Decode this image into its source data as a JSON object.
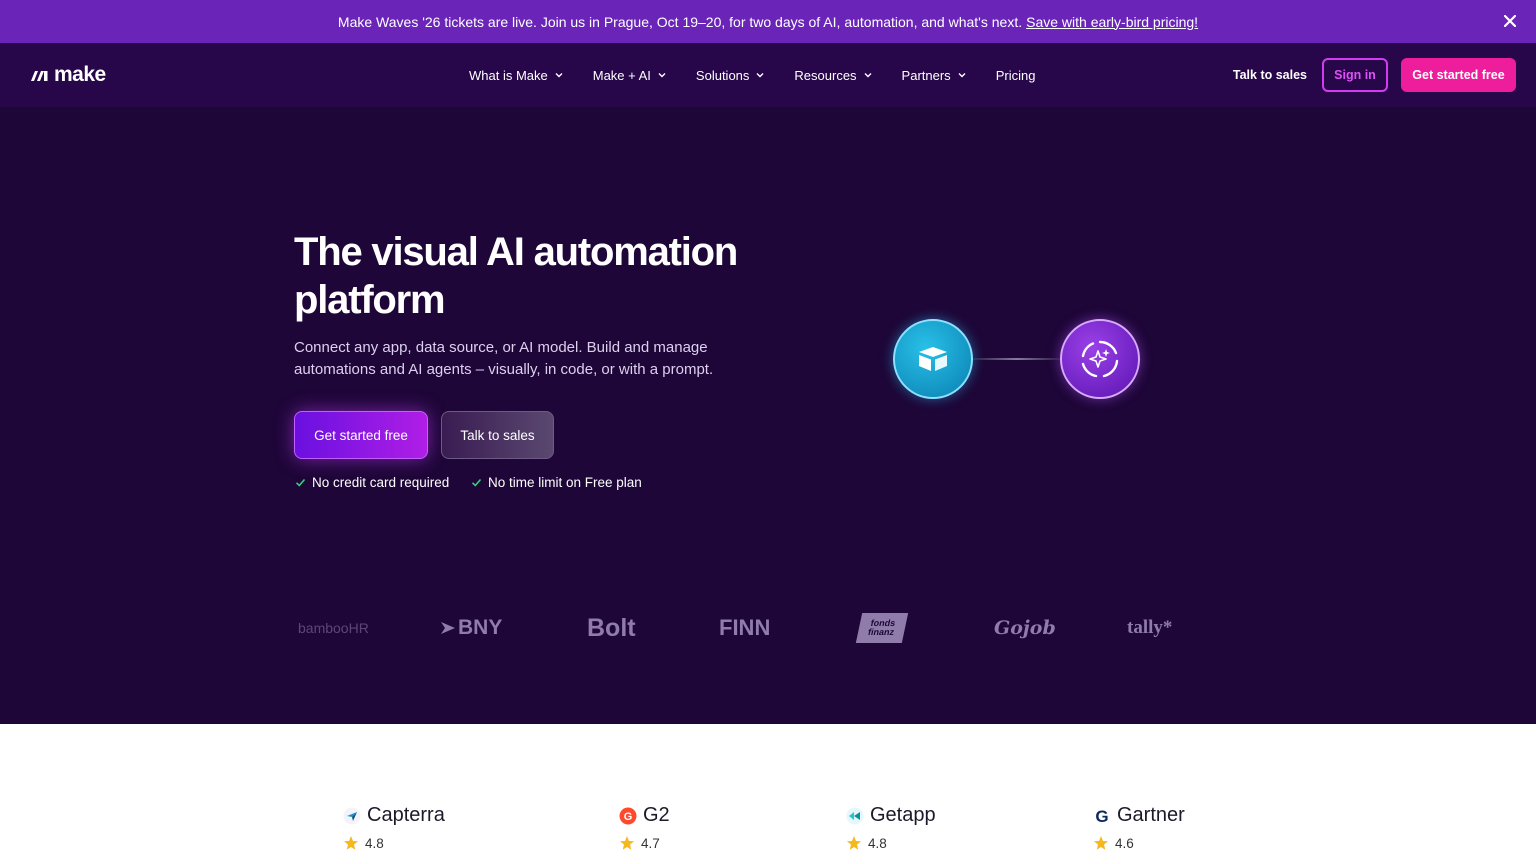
{
  "banner": {
    "text": "Make Waves '26 tickets are live. Join us in Prague, Oct 19–20, for two days of AI, automation, and what's next.",
    "link": "Save with early-bird pricing!"
  },
  "nav": {
    "logo_text": "make",
    "items": [
      {
        "label": "What is Make",
        "dropdown": true
      },
      {
        "label": "Make + AI",
        "dropdown": true
      },
      {
        "label": "Solutions",
        "dropdown": true
      },
      {
        "label": "Resources",
        "dropdown": true
      },
      {
        "label": "Partners",
        "dropdown": true
      },
      {
        "label": "Pricing",
        "dropdown": false
      }
    ],
    "talk_to_sales": "Talk to sales",
    "sign_in": "Sign in",
    "get_started": "Get started free"
  },
  "hero": {
    "title": "The visual AI automation platform",
    "subtitle": "Connect any app, data source, or AI model. Build and manage automations and AI agents – visually, in code, or with a prompt.",
    "primary_cta": "Get started free",
    "secondary_cta": "Talk to sales",
    "checks": [
      "No credit card required",
      "No time limit on Free plan"
    ]
  },
  "customers": [
    "bambooHR",
    "BNY",
    "Bolt",
    "FINN",
    "fonds finanz",
    "Gojob",
    "tally*"
  ],
  "ratings": [
    {
      "name": "Capterra",
      "score": "4.8"
    },
    {
      "name": "G2",
      "score": "4.7"
    },
    {
      "name": "Getapp",
      "score": "4.8"
    },
    {
      "name": "Gartner",
      "score": "4.6"
    }
  ],
  "colors": {
    "background": "#1e0638",
    "banner": "#6a24b8",
    "accent_pink": "#ee1d9b",
    "accent_purple": "#d23cf0"
  }
}
